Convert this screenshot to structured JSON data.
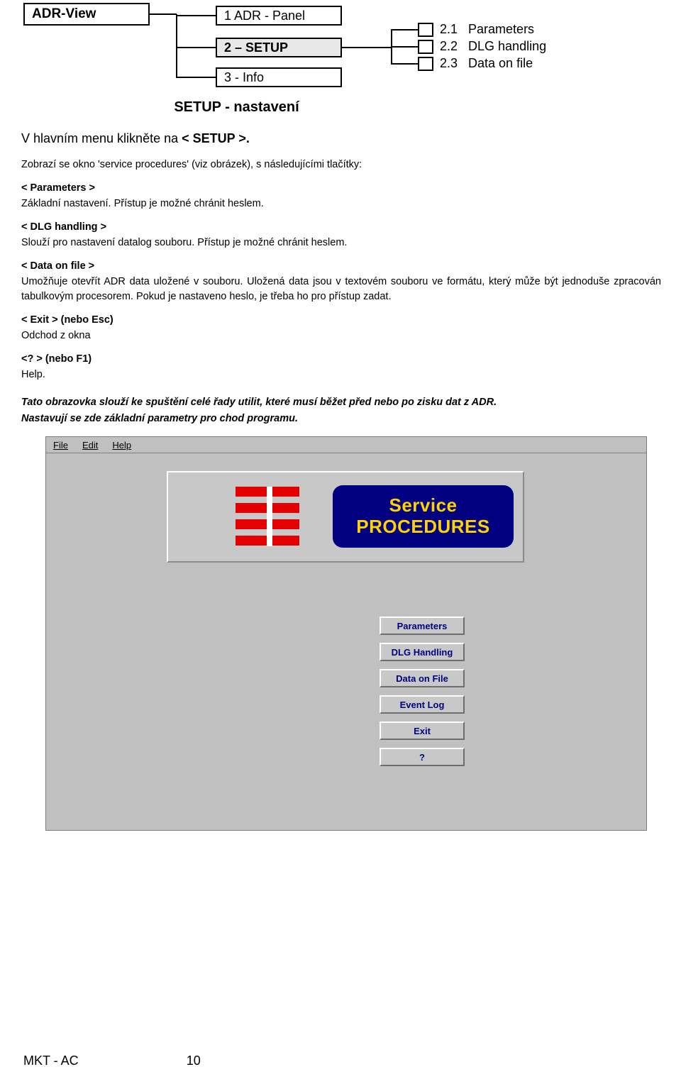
{
  "diagram": {
    "root_label": "ADR-View",
    "menu_items": [
      {
        "label": "1 ADR - Panel"
      },
      {
        "label": "2 – SETUP"
      },
      {
        "label": "3 - Info"
      }
    ],
    "submenu_items": [
      {
        "label": "2.1   Parameters"
      },
      {
        "label": "2.2   DLG handling"
      },
      {
        "label": "2.3   Data on file"
      }
    ]
  },
  "page": {
    "heading": "SETUP - nastavení",
    "lead_prefix": "V hlavním menu klikněte na",
    "lead_target": "< SETUP >.",
    "intro": "Zobrazí se okno 'service procedures'  (viz obrázek), s následujícími tlačítky:",
    "sections": [
      {
        "title": "< Parameters >",
        "body": "Základní nastavení. Přístup je možné chránit heslem."
      },
      {
        "title": "< DLG handling >",
        "body": "Slouží pro nastavení datalog souboru. Přístup je možné chránit heslem."
      },
      {
        "title": "< Data on file >",
        "body": "Umožňuje otevřít ADR data uložené v souboru. Uložená data jsou v textovém souboru ve formátu, který může být jednoduše zpracován tabulkovým procesorem. Pokud je nastaveno heslo, je třeba ho pro přístup zadat."
      },
      {
        "title": "< Exit > (nebo Esc)",
        "body": "Odchod z okna"
      },
      {
        "title": " <? > (nebo F1)",
        "body": "Help."
      }
    ],
    "closing_1": "Tato obrazovka slouží ke spuštění celé řady utilit, které musí běžet před nebo po zisku dat z ADR.",
    "closing_2": "Nastavují se zde základní parametry pro chod programu."
  },
  "screenshot": {
    "menus": [
      "File",
      "Edit",
      "Help"
    ],
    "title_line_1": "Service",
    "title_line_2": "PROCEDURES",
    "buttons": [
      "Parameters",
      "DLG Handling",
      "Data on File",
      "Event Log",
      "Exit",
      "?"
    ]
  },
  "footer": {
    "left": "MKT - AC",
    "page": "10"
  },
  "colors": {
    "flag_red": "#e40000",
    "button_navy": "#000080",
    "button_text_yellow": "#ffd200",
    "window_gray": "#c0c0c0"
  }
}
